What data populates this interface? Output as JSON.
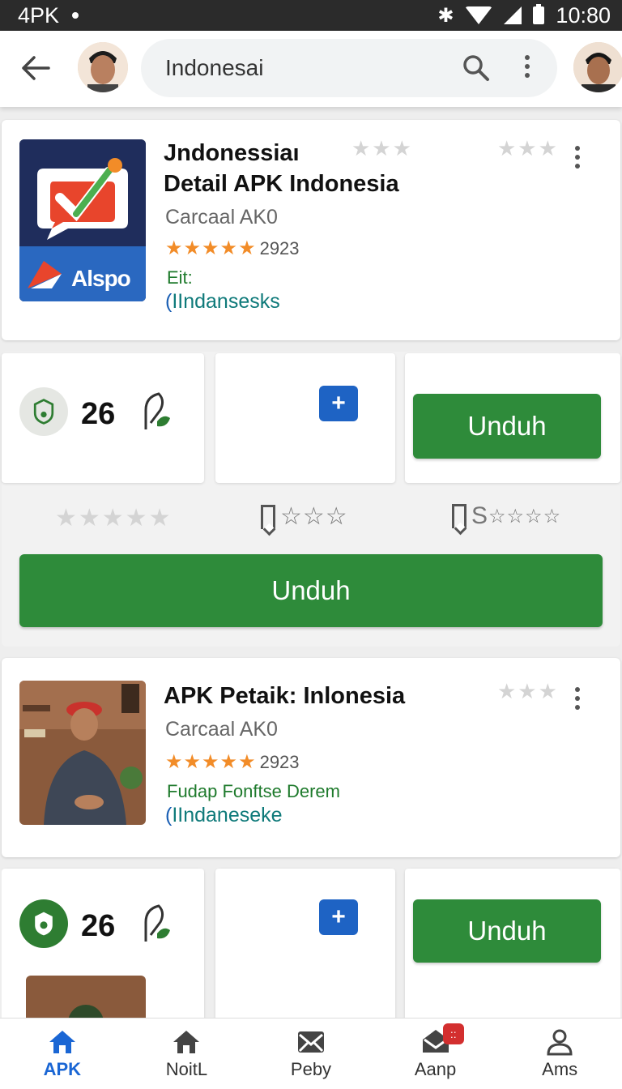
{
  "status_bar": {
    "carrier": "4PK",
    "time": "10:80"
  },
  "search": {
    "query": "Indonesai"
  },
  "cards": [
    {
      "title_line1": "Jndonessiaı",
      "title_line2": "Detail APK Indonesia",
      "subtitle": "Carcaal AK0",
      "rating_stars": "★★★★★",
      "year": "2923",
      "tag": "Eit:",
      "link": "IIndansesks",
      "icon_label": "Alspo"
    },
    {
      "title_line1": "APK Petaik: Inlonesia",
      "subtitle": "Carcaal AK0",
      "rating_stars": "★★★★★",
      "year": "2923",
      "tag": "Fudap Fonftse Derem",
      "link": "IIndaneseke"
    }
  ],
  "info_rows": [
    {
      "count": "26",
      "plus": "+",
      "download": "Unduh",
      "extra_label": "S"
    },
    {
      "count": "26",
      "plus": "+",
      "download": "Unduh"
    }
  ],
  "download_full": "Unduh",
  "bottom_nav": [
    {
      "label": "APK",
      "active": true,
      "icon": "home-icon"
    },
    {
      "label": "NoitL",
      "active": false,
      "icon": "house-icon"
    },
    {
      "label": "Peby",
      "active": false,
      "icon": "mail-icon"
    },
    {
      "label": "Aanp",
      "active": false,
      "icon": "inbox-icon",
      "badge": "::"
    },
    {
      "label": "Ams",
      "active": false,
      "icon": "person-icon"
    }
  ],
  "colors": {
    "accent_green": "#2e8b3a",
    "rating_orange": "#f28c28",
    "active_blue": "#1a66d4"
  }
}
